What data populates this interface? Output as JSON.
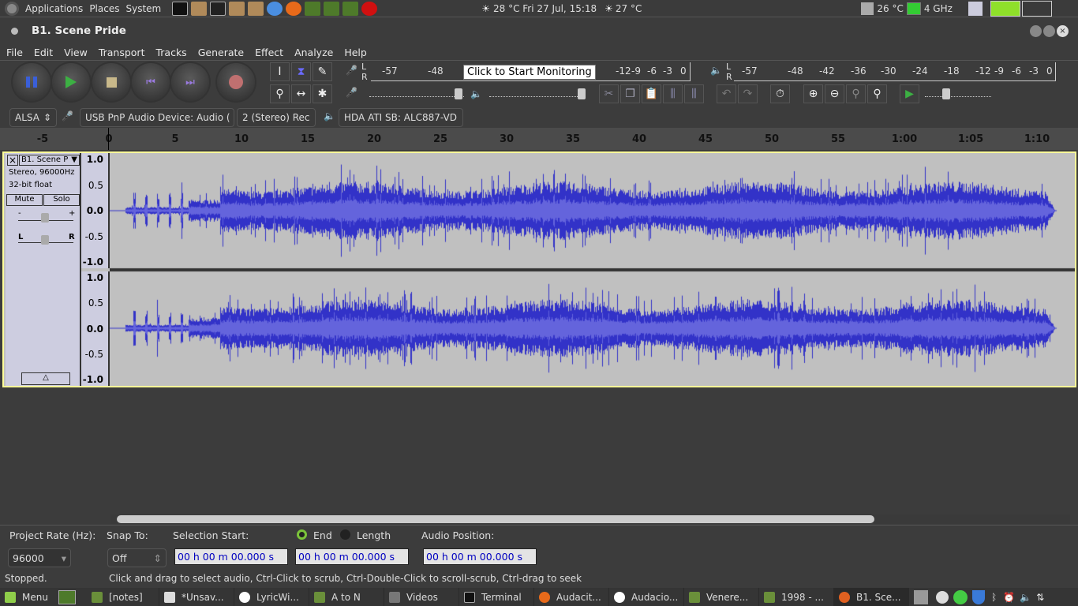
{
  "top_panel": {
    "menus": [
      "Applications",
      "Places",
      "System"
    ],
    "weather1": "28 °C Fri 27 Jul, 15:18",
    "weather2": "27 °C",
    "cpu_temp": "26 °C",
    "cpu_freq": "4 GHz"
  },
  "window": {
    "title": "B1. Scene Pride"
  },
  "menu": [
    "File",
    "Edit",
    "View",
    "Transport",
    "Tracks",
    "Generate",
    "Effect",
    "Analyze",
    "Help"
  ],
  "transport": [
    {
      "name": "pause",
      "color": "#3a5fd8"
    },
    {
      "name": "play",
      "color": "#3cb043"
    },
    {
      "name": "stop",
      "color": "#c8b88a"
    },
    {
      "name": "skip-start",
      "color": "#9a7ae0"
    },
    {
      "name": "skip-end",
      "color": "#9a7ae0"
    },
    {
      "name": "record",
      "color": "#c07070"
    }
  ],
  "meters": {
    "record_ticks": [
      "-57",
      "-48",
      "-12",
      "-9",
      "-6",
      "-3",
      "0"
    ],
    "record_tooltip": "Click to Start Monitoring",
    "play_ticks": [
      "-57",
      "-48",
      "-42",
      "-36",
      "-30",
      "-24",
      "-18",
      "-12",
      "-9",
      "-6",
      "-3",
      "0"
    ],
    "L": "L",
    "R": "R"
  },
  "devices": {
    "host": "ALSA",
    "input": "USB PnP Audio Device: Audio (",
    "channels": "2 (Stereo) Rec",
    "output": "HDA ATI SB: ALC887-VD"
  },
  "ruler": {
    "labels": [
      "-5",
      "0",
      "5",
      "10",
      "15",
      "20",
      "25",
      "30",
      "35",
      "40",
      "45",
      "50",
      "55",
      "1:00",
      "1:05",
      "1:10"
    ],
    "seconds": [
      -5,
      0,
      5,
      10,
      15,
      20,
      25,
      30,
      35,
      40,
      45,
      50,
      55,
      60,
      65,
      70
    ]
  },
  "track": {
    "name": "B1. Scene P",
    "format": "Stereo, 96000Hz",
    "bits": "32-bit float",
    "mute": "Mute",
    "solo": "Solo",
    "gain_minus": "-",
    "gain_plus": "+",
    "pan_l": "L",
    "pan_r": "R",
    "scale": [
      "1.0",
      "0.5",
      "0.0",
      "-0.5",
      "-1.0"
    ],
    "wave_color": "#3232c8",
    "rms_color": "#6464dc"
  },
  "selection": {
    "rate_label": "Project Rate (Hz):",
    "rate": "96000",
    "snap_label": "Snap To:",
    "snap": "Off",
    "start_label": "Selection Start:",
    "end_label": "End",
    "length_label": "Length",
    "pos_label": "Audio Position:",
    "start": "00 h 00 m 00.000 s",
    "end": "00 h 00 m 00.000 s",
    "position": "00 h 00 m 00.000 s"
  },
  "status": {
    "state": "Stopped.",
    "hint": "Click and drag to select audio, Ctrl-Click to scrub, Ctrl-Double-Click to scroll-scrub, Ctrl-drag to seek"
  },
  "taskbar": {
    "menu": "Menu",
    "tasks": [
      "[notes]",
      "*Unsav...",
      "LyricWi...",
      "A  to N",
      "Videos",
      "Terminal",
      "Audacit...",
      "Audacio...",
      "Venere...",
      "1998 - ...",
      "B1. Sce..."
    ]
  }
}
